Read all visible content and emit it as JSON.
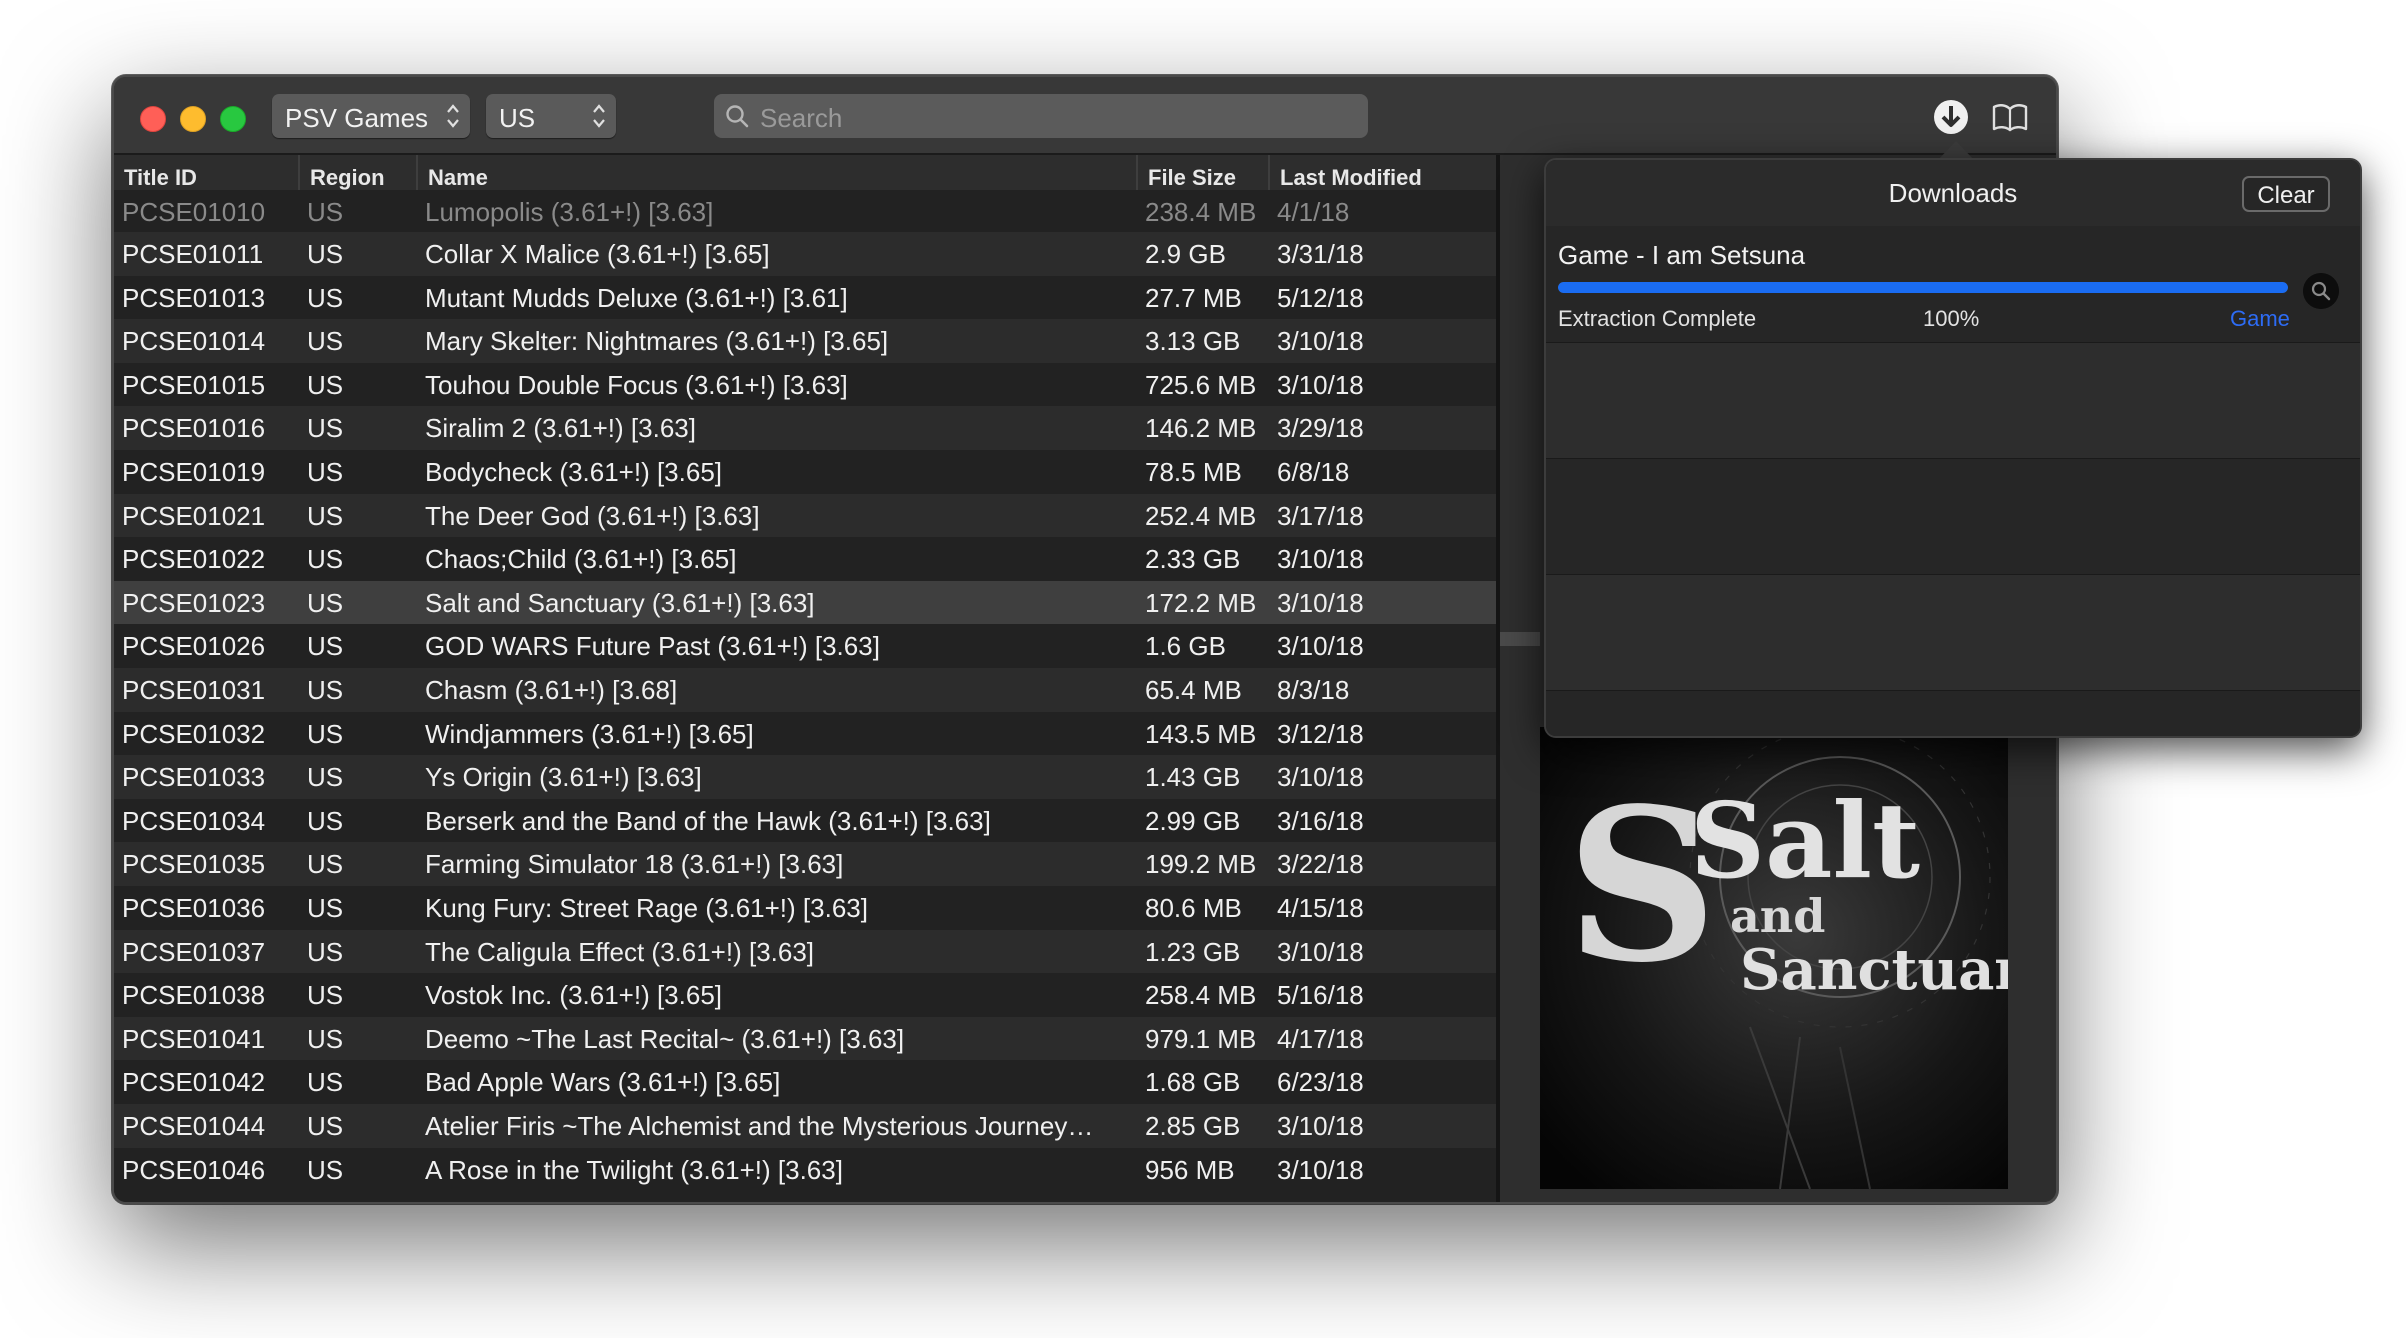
{
  "toolbar": {
    "source_selected": "PSV Games",
    "region_selected": "US",
    "search_placeholder": "Search"
  },
  "table": {
    "columns": [
      "Title ID",
      "Region",
      "Name",
      "File Size",
      "Last Modified"
    ],
    "partial_row": {
      "id": "PCSE01010",
      "region": "US",
      "name": "Lumopolis (3.61+!) [3.63]",
      "size": "238.4 MB",
      "modified": "4/1/18"
    },
    "rows": [
      {
        "id": "PCSE01011",
        "region": "US",
        "name": "Collar X Malice (3.61+!) [3.65]",
        "size": "2.9 GB",
        "modified": "3/31/18"
      },
      {
        "id": "PCSE01013",
        "region": "US",
        "name": "Mutant Mudds Deluxe (3.61+!) [3.61]",
        "size": "27.7 MB",
        "modified": "5/12/18"
      },
      {
        "id": "PCSE01014",
        "region": "US",
        "name": "Mary Skelter: Nightmares (3.61+!) [3.65]",
        "size": "3.13 GB",
        "modified": "3/10/18"
      },
      {
        "id": "PCSE01015",
        "region": "US",
        "name": "Touhou Double Focus (3.61+!) [3.63]",
        "size": "725.6 MB",
        "modified": "3/10/18"
      },
      {
        "id": "PCSE01016",
        "region": "US",
        "name": "Siralim 2 (3.61+!) [3.63]",
        "size": "146.2 MB",
        "modified": "3/29/18"
      },
      {
        "id": "PCSE01019",
        "region": "US",
        "name": "Bodycheck (3.61+!) [3.65]",
        "size": "78.5 MB",
        "modified": "6/8/18"
      },
      {
        "id": "PCSE01021",
        "region": "US",
        "name": "The Deer God (3.61+!) [3.63]",
        "size": "252.4 MB",
        "modified": "3/17/18"
      },
      {
        "id": "PCSE01022",
        "region": "US",
        "name": "Chaos;Child (3.61+!) [3.65]",
        "size": "2.33 GB",
        "modified": "3/10/18"
      },
      {
        "id": "PCSE01023",
        "region": "US",
        "name": "Salt and Sanctuary (3.61+!) [3.63]",
        "size": "172.2 MB",
        "modified": "3/10/18"
      },
      {
        "id": "PCSE01026",
        "region": "US",
        "name": "GOD WARS Future Past (3.61+!) [3.63]",
        "size": "1.6 GB",
        "modified": "3/10/18"
      },
      {
        "id": "PCSE01031",
        "region": "US",
        "name": "Chasm (3.61+!) [3.68]",
        "size": "65.4 MB",
        "modified": "8/3/18"
      },
      {
        "id": "PCSE01032",
        "region": "US",
        "name": "Windjammers (3.61+!) [3.65]",
        "size": "143.5 MB",
        "modified": "3/12/18"
      },
      {
        "id": "PCSE01033",
        "region": "US",
        "name": "Ys Origin (3.61+!) [3.63]",
        "size": "1.43 GB",
        "modified": "3/10/18"
      },
      {
        "id": "PCSE01034",
        "region": "US",
        "name": "Berserk and the Band of the Hawk (3.61+!) [3.63]",
        "size": "2.99 GB",
        "modified": "3/16/18"
      },
      {
        "id": "PCSE01035",
        "region": "US",
        "name": "Farming Simulator 18 (3.61+!) [3.63]",
        "size": "199.2 MB",
        "modified": "3/22/18"
      },
      {
        "id": "PCSE01036",
        "region": "US",
        "name": "Kung Fury: Street Rage (3.61+!) [3.63]",
        "size": "80.6 MB",
        "modified": "4/15/18"
      },
      {
        "id": "PCSE01037",
        "region": "US",
        "name": "The Caligula Effect (3.61+!) [3.63]",
        "size": "1.23 GB",
        "modified": "3/10/18"
      },
      {
        "id": "PCSE01038",
        "region": "US",
        "name": "Vostok Inc. (3.61+!) [3.65]",
        "size": "258.4 MB",
        "modified": "5/16/18"
      },
      {
        "id": "PCSE01041",
        "region": "US",
        "name": "Deemo ~The Last Recital~ (3.61+!) [3.63]",
        "size": "979.1 MB",
        "modified": "4/17/18"
      },
      {
        "id": "PCSE01042",
        "region": "US",
        "name": "Bad Apple Wars (3.61+!) [3.65]",
        "size": "1.68 GB",
        "modified": "6/23/18"
      },
      {
        "id": "PCSE01044",
        "region": "US",
        "name": "Atelier Firis ~The Alchemist and the Mysterious Journey…",
        "size": "2.85 GB",
        "modified": "3/10/18"
      },
      {
        "id": "PCSE01046",
        "region": "US",
        "name": "A Rose in the Twilight (3.61+!) [3.63]",
        "size": "956 MB",
        "modified": "3/10/18"
      }
    ],
    "selected_id": "PCSE01023"
  },
  "cover": {
    "title_line1": "Salt",
    "title_line2": "and",
    "title_line3": "Sanctuary"
  },
  "downloads": {
    "title": "Downloads",
    "clear_label": "Clear",
    "item": {
      "name": "Game - I am Setsuna",
      "status": "Extraction Complete",
      "percent_label": "100%",
      "progress": 1.0,
      "type": "Game"
    }
  },
  "icons": {
    "search": "magnifier-icon",
    "download": "download-arrow-icon",
    "library": "book-icon",
    "reveal": "magnifier-circle-icon"
  },
  "colors": {
    "accent": "#1a6cf2",
    "link": "#2d6cf5",
    "window_bg": "#2a2a2a"
  }
}
